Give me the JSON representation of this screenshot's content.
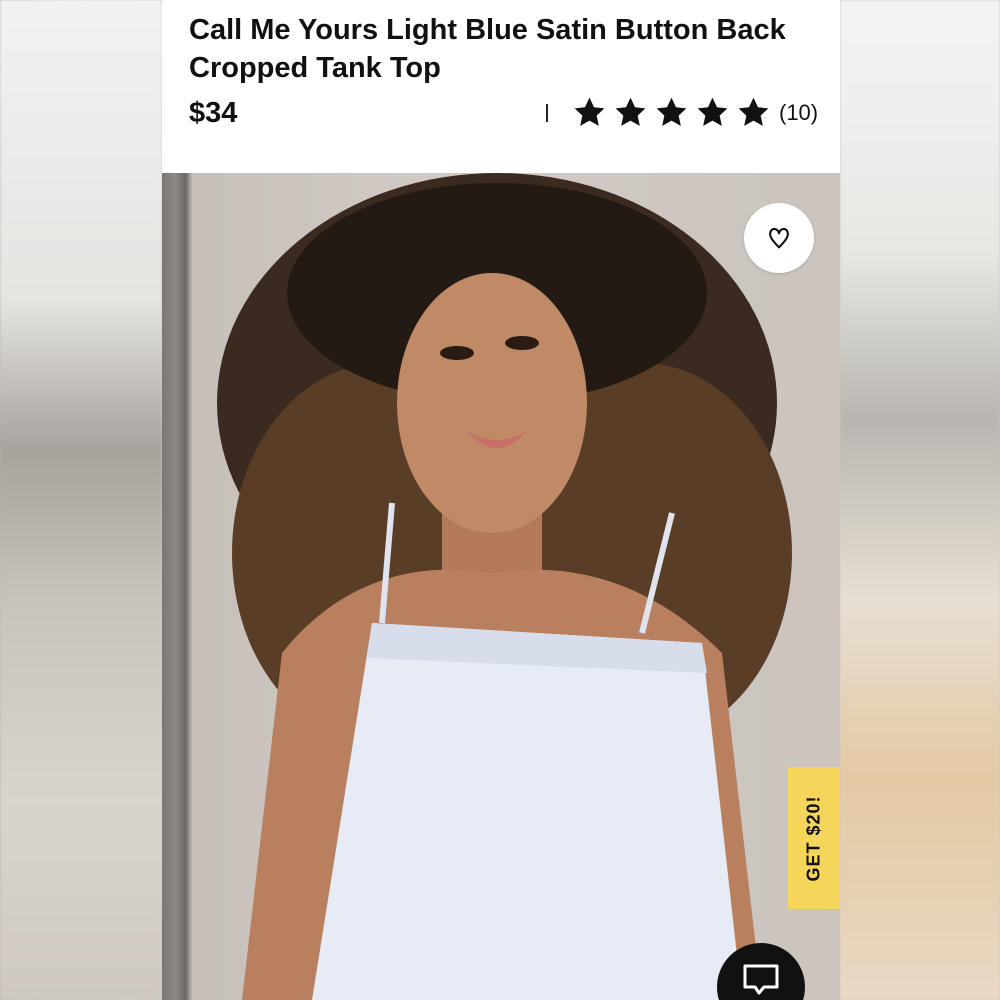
{
  "product": {
    "title": "Call Me Yours Light Blue Satin Button Back Cropped Tank Top",
    "price": "$34",
    "rating": {
      "stars": 5,
      "max_stars": 5,
      "review_count_label": "(10)"
    }
  },
  "promo": {
    "label": "GET $20!"
  },
  "icons": {
    "wishlist": "heart-icon",
    "chat": "chat-icon",
    "star": "star-icon"
  },
  "colors": {
    "promo_background": "#f5d55a",
    "text": "#111111",
    "chat_button": "#111111"
  }
}
